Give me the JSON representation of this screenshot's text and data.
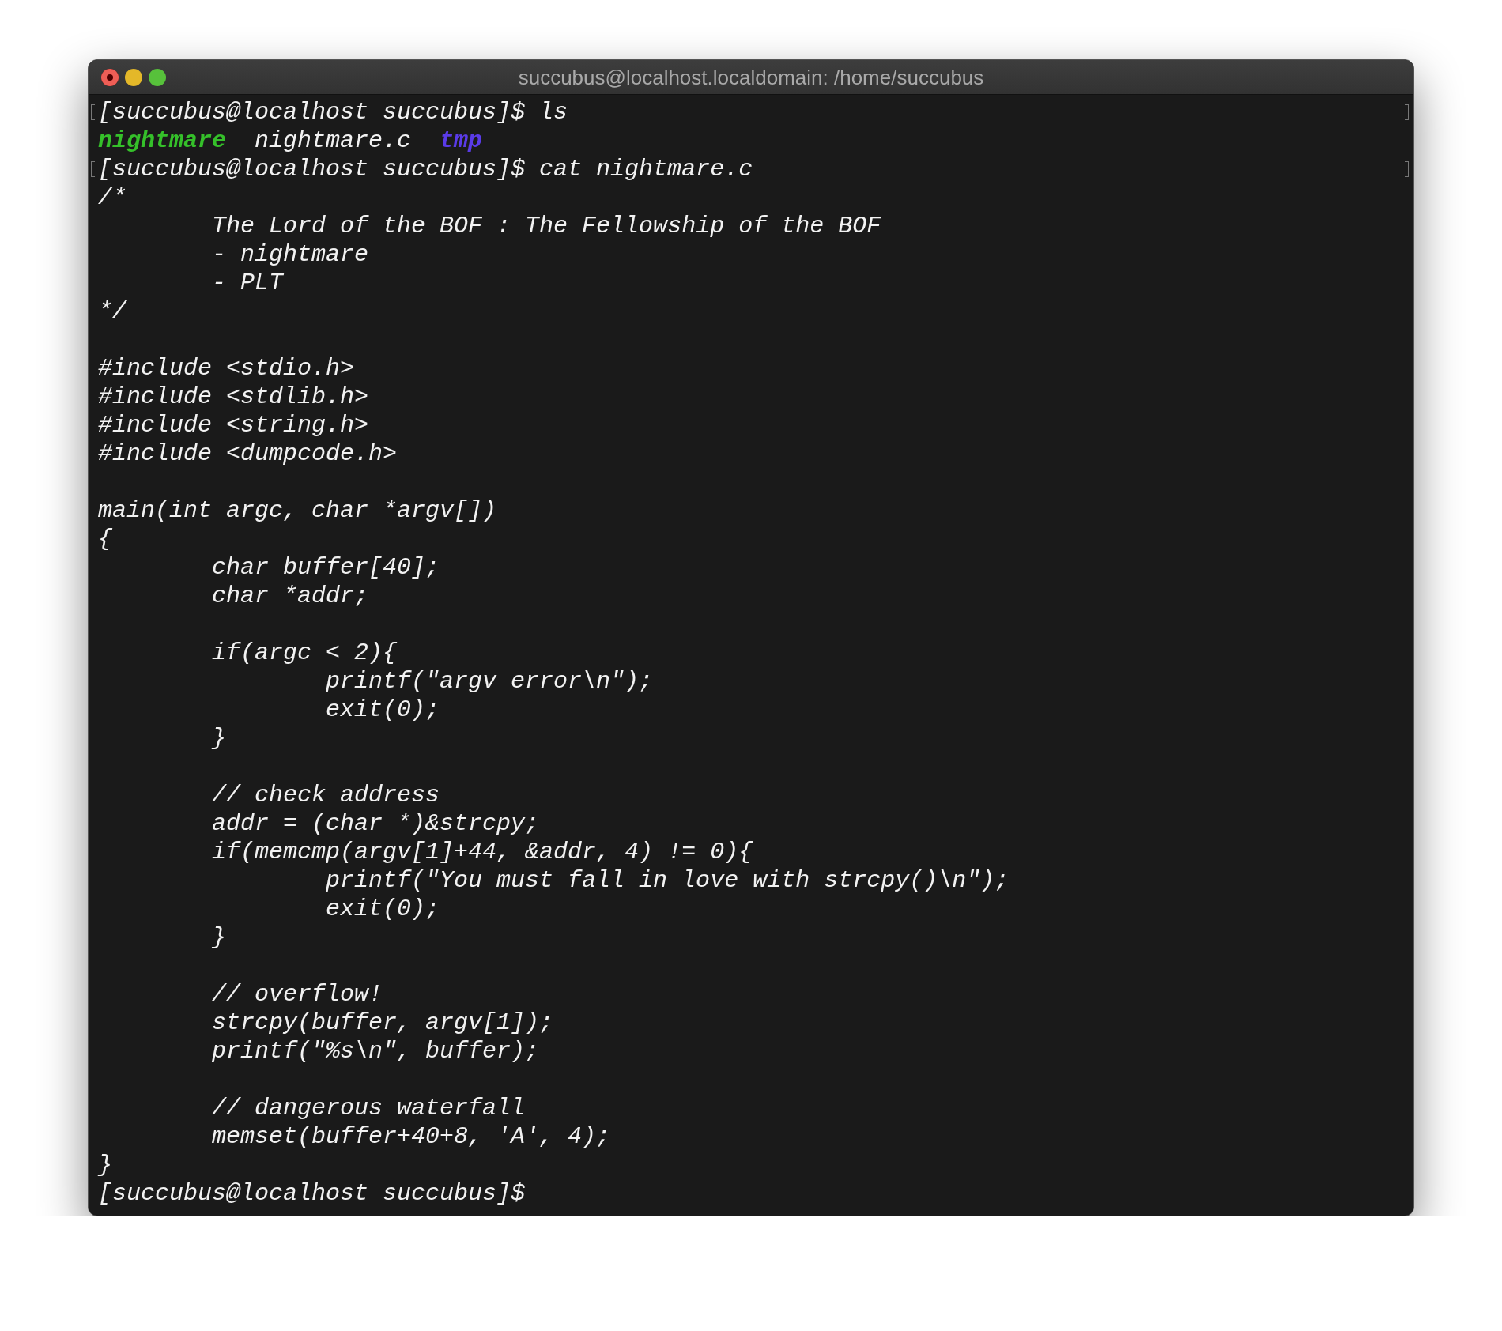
{
  "window": {
    "title": "succubus@localhost.localdomain: /home/succubus",
    "controls": [
      {
        "kind": "close"
      },
      {
        "kind": "minimize"
      },
      {
        "kind": "zoom"
      }
    ]
  },
  "lines": [
    {
      "kind": "prompt",
      "text": "[succubus@localhost succubus]$ ls",
      "marked": true
    },
    {
      "kind": "listing",
      "marked": false,
      "entries": [
        {
          "text": "nightmare",
          "kind": "executable"
        },
        {
          "text": "nightmare.c",
          "kind": "file"
        },
        {
          "text": "tmp",
          "kind": "directory"
        }
      ]
    },
    {
      "kind": "prompt",
      "text": "[succubus@localhost succubus]$ cat nightmare.c",
      "marked": true
    },
    {
      "kind": "output",
      "text": "/*",
      "marked": false
    },
    {
      "kind": "output",
      "text": "\tThe Lord of the BOF : The Fellowship of the BOF",
      "marked": false
    },
    {
      "kind": "output",
      "text": "\t- nightmare",
      "marked": false
    },
    {
      "kind": "output",
      "text": "\t- PLT",
      "marked": false
    },
    {
      "kind": "output",
      "text": "*/",
      "marked": false
    },
    {
      "kind": "blank",
      "marked": false
    },
    {
      "kind": "output",
      "text": "#include <stdio.h>",
      "marked": false
    },
    {
      "kind": "output",
      "text": "#include <stdlib.h>",
      "marked": false
    },
    {
      "kind": "output",
      "text": "#include <string.h>",
      "marked": false
    },
    {
      "kind": "output",
      "text": "#include <dumpcode.h>",
      "marked": false
    },
    {
      "kind": "blank",
      "marked": false
    },
    {
      "kind": "output",
      "text": "main(int argc, char *argv[])",
      "marked": false
    },
    {
      "kind": "output",
      "text": "{",
      "marked": false
    },
    {
      "kind": "output",
      "text": "\tchar buffer[40];",
      "marked": false
    },
    {
      "kind": "output",
      "text": "\tchar *addr;",
      "marked": false
    },
    {
      "kind": "blank",
      "marked": false
    },
    {
      "kind": "output",
      "text": "\tif(argc < 2){",
      "marked": false
    },
    {
      "kind": "output",
      "text": "\t\tprintf(\"argv error\\n\");",
      "marked": false
    },
    {
      "kind": "output",
      "text": "\t\texit(0);",
      "marked": false
    },
    {
      "kind": "output",
      "text": "\t}",
      "marked": false
    },
    {
      "kind": "blank",
      "marked": false
    },
    {
      "kind": "output",
      "text": "\t// check address",
      "marked": false
    },
    {
      "kind": "output",
      "text": "\taddr = (char *)&strcpy;",
      "marked": false
    },
    {
      "kind": "output",
      "text": "\tif(memcmp(argv[1]+44, &addr, 4) != 0){",
      "marked": false
    },
    {
      "kind": "output",
      "text": "\t\tprintf(\"You must fall in love with strcpy()\\n\");",
      "marked": false
    },
    {
      "kind": "output",
      "text": "\t\texit(0);",
      "marked": false
    },
    {
      "kind": "output",
      "text": "\t}",
      "marked": false
    },
    {
      "kind": "blank",
      "marked": false
    },
    {
      "kind": "output",
      "text": "\t// overflow!",
      "marked": false
    },
    {
      "kind": "output",
      "text": "\tstrcpy(buffer, argv[1]);",
      "marked": false
    },
    {
      "kind": "output",
      "text": "\tprintf(\"%s\\n\", buffer);",
      "marked": false
    },
    {
      "kind": "blank",
      "marked": false
    },
    {
      "kind": "output",
      "text": "\t// dangerous waterfall",
      "marked": false
    },
    {
      "kind": "output",
      "text": "\tmemset(buffer+40+8, 'A', 4);",
      "marked": false
    },
    {
      "kind": "output",
      "text": "}",
      "marked": false
    },
    {
      "kind": "prompt",
      "text": "[succubus@localhost succubus]$",
      "marked": false
    }
  ]
}
